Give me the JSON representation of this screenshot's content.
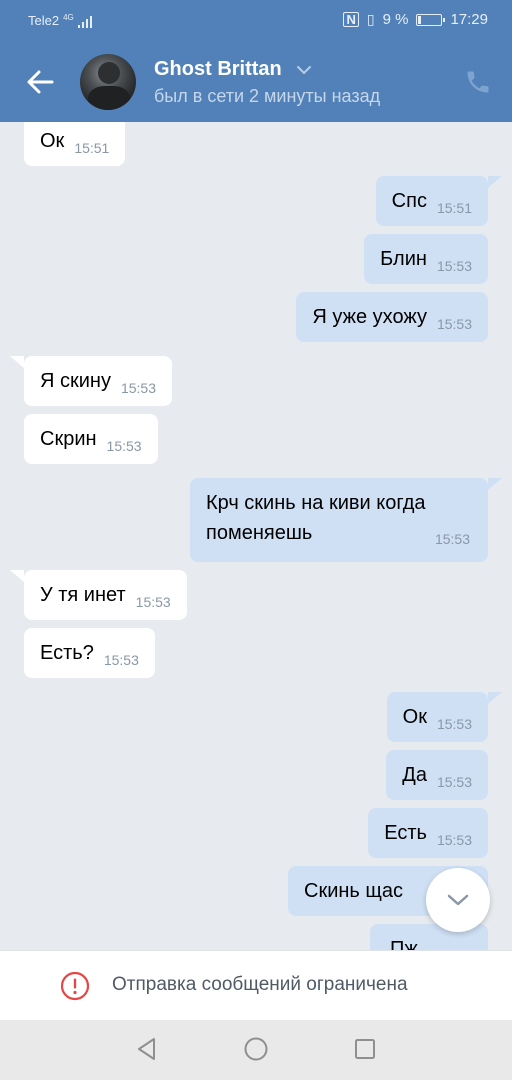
{
  "status_bar": {
    "carrier": "Tele2",
    "network": "4G",
    "battery_percent": "9 %",
    "time": "17:29"
  },
  "header": {
    "contact_name": "Ghost Brittan",
    "contact_status": "был в сети 2 минуты назад",
    "accent_color": "#5181b8"
  },
  "messages": [
    {
      "direction": "in",
      "text": "Ок",
      "time": "15:51"
    },
    {
      "direction": "out",
      "text": "Спс",
      "time": "15:51"
    },
    {
      "direction": "out",
      "text": "Блин",
      "time": "15:53"
    },
    {
      "direction": "out",
      "text": "Я уже ухожу",
      "time": "15:53"
    },
    {
      "direction": "in",
      "text": "Я скину",
      "time": "15:53"
    },
    {
      "direction": "in",
      "text": "Скрин",
      "time": "15:53"
    },
    {
      "direction": "out",
      "text": "Крч скинь на киви когда поменяешь",
      "time": "15:53"
    },
    {
      "direction": "in",
      "text": "У тя инет",
      "time": "15:53"
    },
    {
      "direction": "in",
      "text": "Есть?",
      "time": "15:53"
    },
    {
      "direction": "out",
      "text": "Ок",
      "time": "15:53"
    },
    {
      "direction": "out",
      "text": "Да",
      "time": "15:53"
    },
    {
      "direction": "out",
      "text": "Есть",
      "time": "15:53"
    },
    {
      "direction": "out",
      "text": "Скинь щас",
      "time": ""
    },
    {
      "direction": "out",
      "text": "Пж",
      "time": ""
    }
  ],
  "restriction_notice": {
    "text": "Отправка сообщений ограничена",
    "icon": "alert-circle-icon",
    "icon_color": "#e64646"
  },
  "icons": {
    "back": "arrow-left-icon",
    "phone": "phone-icon",
    "scroll_down": "chevron-down-icon",
    "nav_back": "triangle-back-icon",
    "nav_home": "circle-home-icon",
    "nav_recent": "square-recent-icon"
  }
}
